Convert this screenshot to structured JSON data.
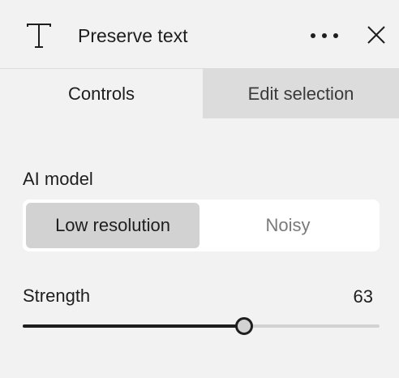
{
  "header": {
    "title": "Preserve text",
    "type_icon": "text-type-icon",
    "more_icon": "more-horizontal-icon",
    "close_icon": "close-icon"
  },
  "tabs": [
    {
      "label": "Controls",
      "active": true
    },
    {
      "label": "Edit selection",
      "active": false
    }
  ],
  "ai_model": {
    "label": "AI model",
    "options": [
      {
        "label": "Low resolution",
        "selected": true
      },
      {
        "label": "Noisy",
        "selected": false
      }
    ]
  },
  "strength": {
    "label": "Strength",
    "value": "63",
    "fraction": 0.62
  },
  "colors": {
    "panel_bg": "#f2f2f2",
    "inactive_tab_bg": "#dcdcdc",
    "selected_option_bg": "#d2d2d2",
    "text": "#1e1e1e",
    "muted_text": "#7a7a7a"
  }
}
